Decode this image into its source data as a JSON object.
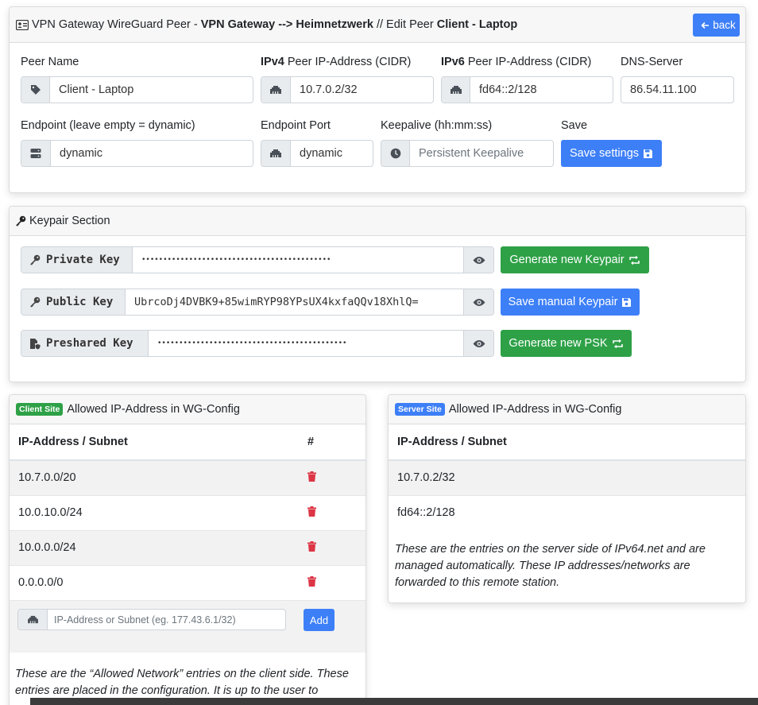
{
  "peer_card": {
    "title_prefix": "VPN Gateway WireGuard Peer -",
    "title_gateway": "VPN Gateway --> Heimnetzwerk",
    "title_mid": "// Edit Peer",
    "title_peer": "Client - Laptop",
    "back_label": "back",
    "peer_name": {
      "label": "Peer Name",
      "value": "Client - Laptop"
    },
    "ipv4": {
      "label_bold": "IPv4",
      "label_rest": "Peer IP-Address (CIDR)",
      "value": "10.7.0.2/32"
    },
    "ipv6": {
      "label_bold": "IPv6",
      "label_rest": "Peer IP-Address (CIDR)",
      "value": "fd64::2/128"
    },
    "dns": {
      "label": "DNS-Server",
      "value": "86.54.11.100"
    },
    "endpoint": {
      "label": "Endpoint (leave empty = dynamic)",
      "value": "dynamic"
    },
    "endpoint_port": {
      "label": "Endpoint Port",
      "value": "dynamic"
    },
    "keepalive": {
      "label": "Keepalive (hh:mm:ss)",
      "placeholder": "Persistent Keepalive"
    },
    "save": {
      "label": "Save",
      "button": "Save settings"
    }
  },
  "keypair_card": {
    "title": "Keypair Section",
    "private_key": {
      "label": "Private Key",
      "value": "••••••••••••••••••••••••••••••••••••••••••••",
      "button": "Generate new Keypair"
    },
    "public_key": {
      "label": "Public Key",
      "value": "UbrcoDj4DVBK9+85wimRYP98YPsUX4kxfaQQv18XhlQ=",
      "button": "Save manual Keypair"
    },
    "preshared_key": {
      "label": "Preshared Key",
      "value": "••••••••••••••••••••••••••••••••••••••••••••",
      "button": "Generate new PSK"
    }
  },
  "client_card": {
    "badge": "Client Site",
    "title": "Allowed IP-Address in WG-Config",
    "col_ip": "IP-Address / Subnet",
    "col_action": "#",
    "rows": [
      "10.7.0.0/20",
      "10.0.10.0/24",
      "10.0.0.0/24",
      "0.0.0.0/0"
    ],
    "input_placeholder": "IP-Address or Subnet (eg. 177.43.6.1/32)",
    "add_button": "Add",
    "note": "These are the “Allowed Network” entries on the client side. These entries are placed in the configuration. It is up to the user to"
  },
  "server_card": {
    "badge": "Server Site",
    "title": "Allowed IP-Address in WG-Config",
    "col_ip": "IP-Address / Subnet",
    "rows": [
      "10.7.0.2/32",
      "fd64::2/128"
    ],
    "note": "These are the entries on the server side of IPv64.net and are managed automatically. These IP addresses/networks are forwarded to this remote station."
  },
  "colors": {
    "primary": "#3d7ff7",
    "success": "#2ea147",
    "danger": "#dc3545"
  }
}
